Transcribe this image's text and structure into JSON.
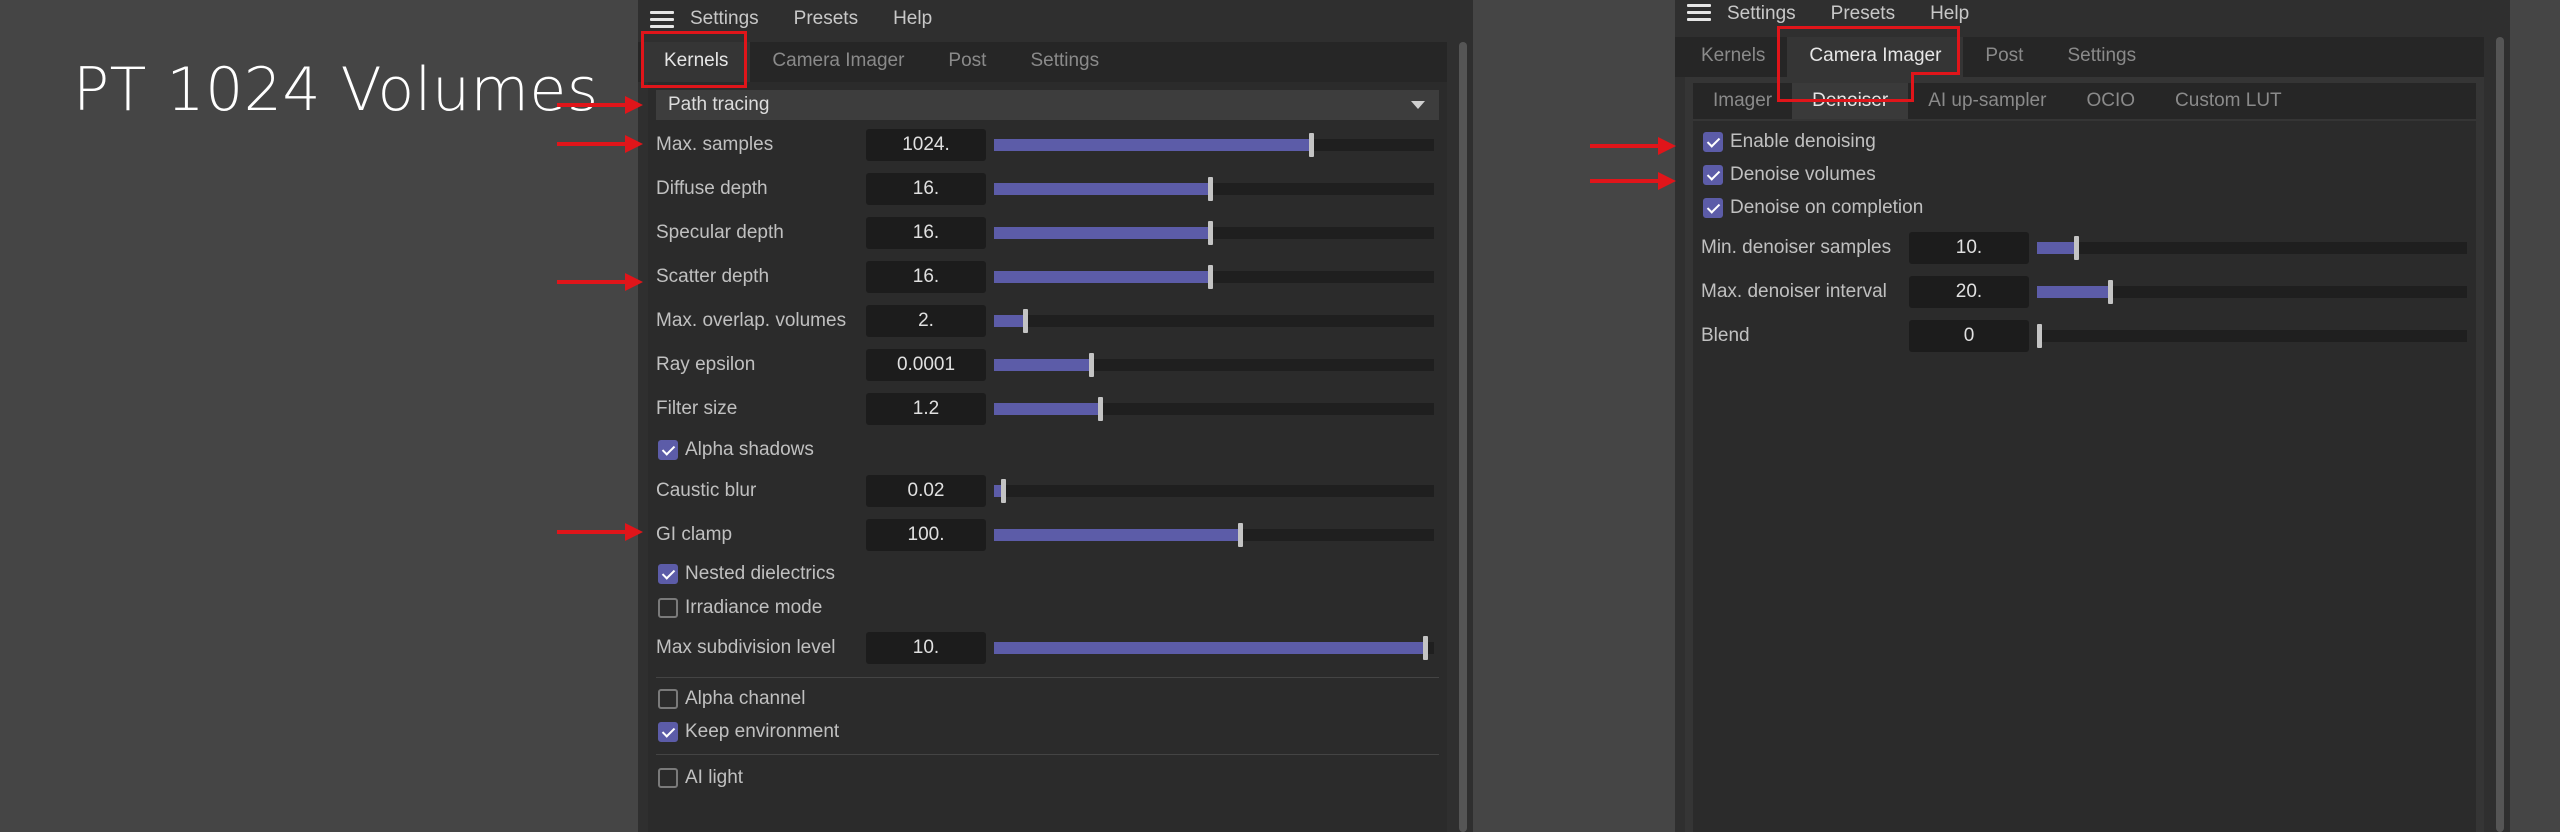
{
  "overlay_title": "PT 1024 Volumes",
  "accent_color": "#5c5ca8",
  "annotation_color": "#e0151a",
  "left_panel": {
    "menu": [
      "Settings",
      "Presets",
      "Help"
    ],
    "tabs": [
      "Kernels",
      "Camera Imager",
      "Post",
      "Settings"
    ],
    "active_tab": "Kernels",
    "kernel_dropdown": "Path tracing",
    "sliders_a": [
      {
        "label": "Max. samples",
        "value": "1024.",
        "fraction": 0.72
      },
      {
        "label": "Diffuse depth",
        "value": "16.",
        "fraction": 0.49
      },
      {
        "label": "Specular depth",
        "value": "16.",
        "fraction": 0.49
      },
      {
        "label": "Scatter depth",
        "value": "16.",
        "fraction": 0.49
      },
      {
        "label": "Max. overlap. volumes",
        "value": "2.",
        "fraction": 0.07
      },
      {
        "label": "Ray epsilon",
        "value": "0.0001",
        "fraction": 0.22
      },
      {
        "label": "Filter size",
        "value": "1.2",
        "fraction": 0.24
      }
    ],
    "alpha_shadows": {
      "label": "Alpha shadows",
      "checked": true
    },
    "sliders_b": [
      {
        "label": "Caustic blur",
        "value": "0.02",
        "fraction": 0.02
      },
      {
        "label": "GI clamp",
        "value": "100.",
        "fraction": 0.56
      }
    ],
    "checks_a": [
      {
        "label": "Nested dielectrics",
        "checked": true
      },
      {
        "label": "Irradiance mode",
        "checked": false
      }
    ],
    "subdivision": {
      "label": "Max subdivision level",
      "value": "10.",
      "fraction": 0.98
    },
    "checks_b": [
      {
        "label": "Alpha channel",
        "checked": false
      },
      {
        "label": "Keep environment",
        "checked": true
      }
    ],
    "ai_light": {
      "label": "AI light",
      "checked": false
    }
  },
  "right_panel": {
    "menu": [
      "Settings",
      "Presets",
      "Help"
    ],
    "tabs": [
      "Kernels",
      "Camera Imager",
      "Post",
      "Settings"
    ],
    "active_tab": "Camera Imager",
    "subtabs": [
      "Imager",
      "Denoiser",
      "AI up-sampler",
      "OCIO",
      "Custom LUT"
    ],
    "active_subtab": "Denoiser",
    "checks": [
      {
        "label": "Enable denoising",
        "checked": true
      },
      {
        "label": "Denoise volumes",
        "checked": true
      },
      {
        "label": "Denoise on completion",
        "checked": true
      }
    ],
    "sliders": [
      {
        "label": "Min. denoiser samples",
        "value": "10.",
        "fraction": 0.09
      },
      {
        "label": "Max. denoiser interval",
        "value": "20.",
        "fraction": 0.17
      },
      {
        "label": "Blend",
        "value": "0",
        "fraction": 0.0
      }
    ]
  }
}
